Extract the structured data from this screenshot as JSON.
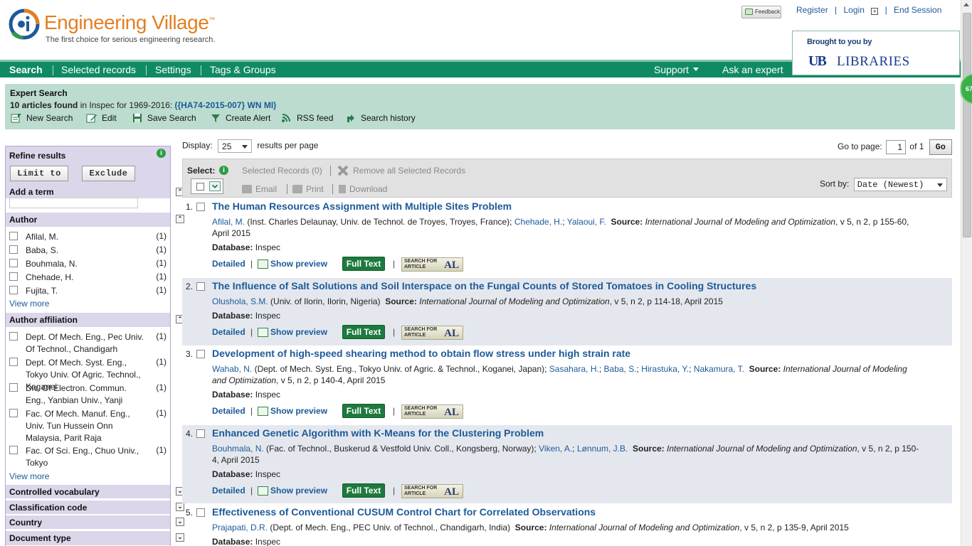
{
  "header": {
    "brand": "Engineering Village",
    "trademark": "™",
    "tagline": "The first choice for serious engineering research.",
    "feedback": "Feedback",
    "links": [
      "Register",
      "Login",
      "End Session"
    ],
    "brought_by": "Brought to you by",
    "library_mark": "UB",
    "library_name": "LIBRARIES",
    "badge": "67"
  },
  "nav": {
    "items": [
      "Search",
      "Selected records",
      "Settings",
      "Tags & Groups"
    ],
    "right": [
      "Support",
      "Ask an expert"
    ]
  },
  "expert": {
    "title": "Expert Search",
    "found_count": "10 articles found",
    "found_mid": " in Inspec for 1969-2016: ",
    "query": "({HA74-2015-007} WN MI)",
    "actions": [
      "New Search",
      "Edit",
      "Save Search",
      "Create Alert",
      "RSS feed",
      "Search history"
    ]
  },
  "sidebar": {
    "title": "Refine results",
    "limit_btn": "Limit to",
    "exclude_btn": "Exclude",
    "add_term": "Add a term",
    "author_head": "Author",
    "authors": [
      {
        "name": "Afilal, M.",
        "count": "(1)"
      },
      {
        "name": "Baba, S.",
        "count": "(1)"
      },
      {
        "name": "Bouhmala, N.",
        "count": "(1)"
      },
      {
        "name": "Chehade, H.",
        "count": "(1)"
      },
      {
        "name": "Fujita, T.",
        "count": "(1)"
      }
    ],
    "view_more": "View more",
    "affil_head": "Author affiliation",
    "affiliations": [
      {
        "name": "Dept. Of Mech. Eng., Pec Univ. Of Technol., Chandigarh",
        "count": "(1)"
      },
      {
        "name": "Dept. Of Mech. Syst. Eng., Tokyo Univ. Of Agric. Technol., Koganei",
        "count": "(1)"
      },
      {
        "name": "Div. Of Electron. Commun. Eng., Yanbian Univ., Yanji",
        "count": "(1)"
      },
      {
        "name": "Fac. Of Mech. Manuf. Eng., Univ. Tun Hussein Onn Malaysia, Parit Raja",
        "count": "(1)"
      },
      {
        "name": "Fac. Of Sci. Eng., Chuo Univ., Tokyo",
        "count": "(1)"
      }
    ],
    "collapsed": [
      "Controlled vocabulary",
      "Classification code",
      "Country",
      "Document type"
    ]
  },
  "results_bar": {
    "display_label": "Display:",
    "display_value": "25",
    "per_page": "results per page",
    "goto_label": "Go to page:",
    "page_value": "1",
    "of_label": "of 1",
    "go": "Go",
    "select_label": "Select:",
    "selected_records": "Selected Records (0)",
    "remove_all": "Remove all Selected Records",
    "email": "Email",
    "print": "Print",
    "download": "Download",
    "sort_label": "Sort by:",
    "sort_value": "Date (Newest)"
  },
  "result_labels": {
    "source": "Source:",
    "database": "Database:",
    "detailed": "Detailed",
    "preview": "Show preview",
    "fulltext": "Full Text",
    "sfa_top": "SEARCH FOR",
    "sfa_bottom": "ARTICLE",
    "sfa_al": "AL"
  },
  "results": [
    {
      "num": "1.",
      "title": "The Human Resources Assignment with Multiple Sites Problem",
      "a1": "Afilal, M.",
      "t1": " (Inst. Charles Delaunay, Univ. de Technol. de Troyes, Troyes, France); ",
      "a2": "Chehade, H.",
      "t2": "; ",
      "a3": "Yalaoui, F.",
      "journal": "International Journal of Modeling and Optimization",
      "tail": ", v 5, n 2, p 155-60, April 2015",
      "db": "Inspec"
    },
    {
      "num": "2.",
      "title": "The Influence of Salt Solutions and Soil Interspace on the Fungal Counts of Stored Tomatoes in Cooling Structures",
      "a1": "Olushola, S.M.",
      "t1": " (Univ. of Ilorin, Ilorin, Nigeria) ",
      "journal": "International Journal of Modeling and Optimization",
      "tail": ", v 5, n 2, p 114-18, April 2015",
      "db": "Inspec"
    },
    {
      "num": "3.",
      "title": "Development of high-speed shearing method to obtain flow stress under high strain rate",
      "a1": "Wahab, N.",
      "t1": " (Dept. of Mech. Syst. Eng., Tokyo Univ. of Agric. & Technol., Koganei, Japan); ",
      "a2": "Sasahara, H.",
      "a3": "Baba, S.",
      "a4": "Hirastuka, Y.",
      "a5": "Nakamura, T.",
      "journal": "International Journal of Modeling and Optimization",
      "tail": ", v 5, n 2, p 140-4, April 2015",
      "db": "Inspec"
    },
    {
      "num": "4.",
      "title": "Enhanced Genetic Algorithm with K-Means for the Clustering Problem",
      "a1": "Bouhmala, N.",
      "t1": " (Fac. of Technol., Buskerud & Vestfold Univ. Coll., Kongsberg, Norway); ",
      "a2": "Viken, A.",
      "a3": "Lønnum, J.B.",
      "journal": "International Journal of Modeling and Optimization",
      "tail": ", v 5, n 2, p 150-4, April 2015",
      "db": "Inspec"
    },
    {
      "num": "5.",
      "title": "Effectiveness of Conventional CUSUM Control Chart for Correlated Observations",
      "a1": "Prajapati, D.R.",
      "t1": " (Dept. of Mech. Eng., PEC Univ. of Technol., Chandigarh, India) ",
      "journal": "International Journal of Modeling and Optimization",
      "tail": ", v 5, n 2, p 135-9, April 2015",
      "db": "Inspec"
    }
  ]
}
